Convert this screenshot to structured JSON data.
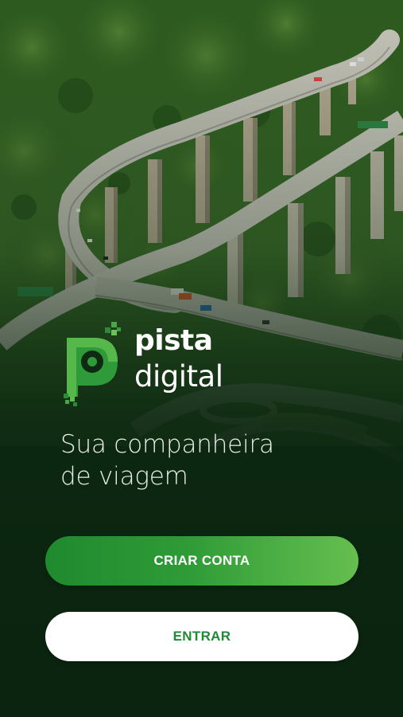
{
  "brand": {
    "name_line1": "pista",
    "name_line2": "digital"
  },
  "tagline": {
    "line1": "Sua companheira",
    "line2": "de viagem"
  },
  "actions": {
    "create_account_label": "CRIAR CONTA",
    "login_label": "ENTRAR"
  },
  "colors": {
    "brand_green": "#2e9b37",
    "brand_light_green": "#66bf4f",
    "dark_background": "#0b2410",
    "secondary_text": "#1f8a35"
  },
  "icons": {
    "logo": "pista-digital-logo-icon"
  }
}
